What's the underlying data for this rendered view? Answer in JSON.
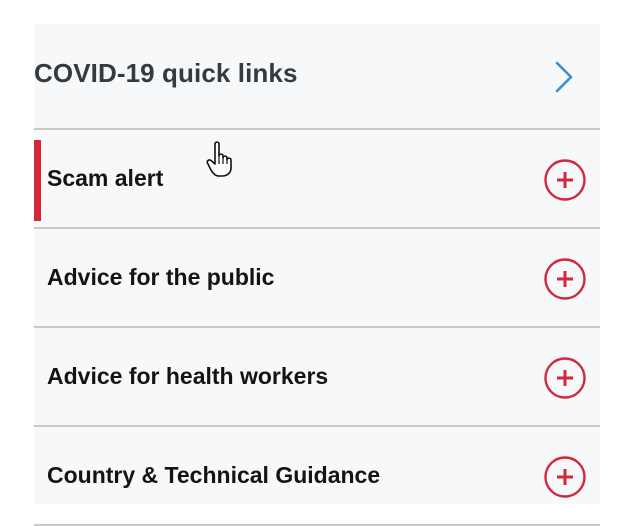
{
  "header": {
    "title": "COVID-19 quick links",
    "chevron_icon": "chevron-right-icon"
  },
  "items": [
    {
      "label": "Scam alert",
      "icon": "plus-circle-icon",
      "highlighted": true
    },
    {
      "label": "Advice for the public",
      "icon": "plus-circle-icon",
      "highlighted": false
    },
    {
      "label": "Advice for health workers",
      "icon": "plus-circle-icon",
      "highlighted": false
    },
    {
      "label": "Country & Technical Guidance",
      "icon": "plus-circle-icon",
      "highlighted": false
    }
  ],
  "colors": {
    "accent": "#d2283c",
    "chevron": "#3a8fd0",
    "text": "#141414",
    "header_text": "#333a40",
    "panel_bg": "#f7f8fa",
    "divider": "#c9c9c9"
  },
  "cursor_icon": "hand-pointer-icon"
}
